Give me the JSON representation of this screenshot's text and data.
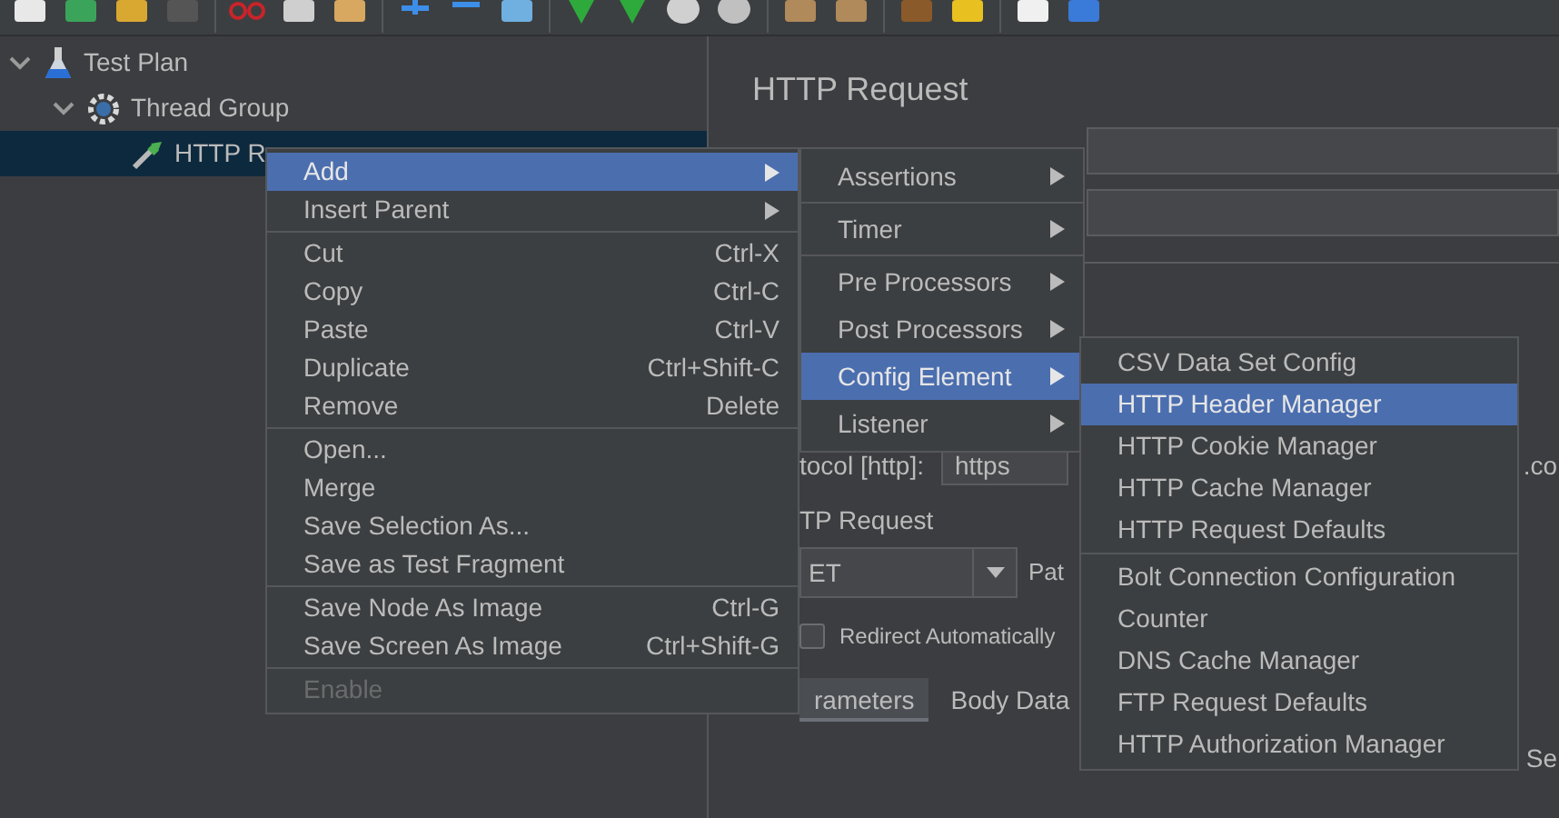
{
  "tree": [
    {
      "label": "Test Plan",
      "kind": "test_plan",
      "expanded": true,
      "selected": false,
      "children": [
        {
          "label": "Thread Group",
          "kind": "thread_group",
          "expanded": true,
          "selected": false,
          "children": [
            {
              "label": "HTTP R",
              "kind": "sampler",
              "selected": true
            }
          ]
        }
      ]
    }
  ],
  "panel": {
    "title": "HTTP Request",
    "protocol_label": "tocol [http]:",
    "protocol_value": "https",
    "server_fragment": ".co",
    "fieldset_legend": "TP Request",
    "method_value": "ET",
    "path_label": "Pat",
    "redirect": {
      "label": "Redirect Automatically",
      "checked": false
    },
    "tabs": [
      {
        "label": "rameters",
        "selected": true
      },
      {
        "label": "Body Data",
        "selected": false
      }
    ],
    "right_fragment": "Se"
  },
  "context_menu": {
    "items": [
      {
        "kind": "item",
        "label": "Add",
        "submenu": true,
        "selected": true,
        "disabled": false
      },
      {
        "kind": "item",
        "label": "Insert Parent",
        "submenu": true,
        "selected": false,
        "disabled": false
      },
      {
        "kind": "separator"
      },
      {
        "kind": "item",
        "label": "Cut",
        "shortcut": "Ctrl-X",
        "submenu": false,
        "selected": false,
        "disabled": false
      },
      {
        "kind": "item",
        "label": "Copy",
        "shortcut": "Ctrl-C",
        "submenu": false,
        "selected": false,
        "disabled": false
      },
      {
        "kind": "item",
        "label": "Paste",
        "shortcut": "Ctrl-V",
        "submenu": false,
        "selected": false,
        "disabled": false
      },
      {
        "kind": "item",
        "label": "Duplicate",
        "shortcut": "Ctrl+Shift-C",
        "submenu": false,
        "selected": false,
        "disabled": false
      },
      {
        "kind": "item",
        "label": "Remove",
        "shortcut": "Delete",
        "submenu": false,
        "selected": false,
        "disabled": false
      },
      {
        "kind": "separator"
      },
      {
        "kind": "item",
        "label": "Open...",
        "submenu": false,
        "selected": false,
        "disabled": false
      },
      {
        "kind": "item",
        "label": "Merge",
        "submenu": false,
        "selected": false,
        "disabled": false
      },
      {
        "kind": "item",
        "label": "Save Selection As...",
        "submenu": false,
        "selected": false,
        "disabled": false
      },
      {
        "kind": "item",
        "label": "Save as Test Fragment",
        "submenu": false,
        "selected": false,
        "disabled": false
      },
      {
        "kind": "separator"
      },
      {
        "kind": "item",
        "label": "Save Node As Image",
        "shortcut": "Ctrl-G",
        "submenu": false,
        "selected": false,
        "disabled": false
      },
      {
        "kind": "item",
        "label": "Save Screen As Image",
        "shortcut": "Ctrl+Shift-G",
        "submenu": false,
        "selected": false,
        "disabled": false
      },
      {
        "kind": "separator"
      },
      {
        "kind": "item",
        "label": "Enable",
        "submenu": false,
        "selected": false,
        "disabled": true
      }
    ]
  },
  "add_submenu": {
    "items": [
      {
        "kind": "item",
        "label": "Assertions",
        "submenu": true,
        "selected": false
      },
      {
        "kind": "separator"
      },
      {
        "kind": "item",
        "label": "Timer",
        "submenu": true,
        "selected": false
      },
      {
        "kind": "separator"
      },
      {
        "kind": "item",
        "label": "Pre Processors",
        "submenu": true,
        "selected": false
      },
      {
        "kind": "item",
        "label": "Post Processors",
        "submenu": true,
        "selected": false
      },
      {
        "kind": "item",
        "label": "Config Element",
        "submenu": true,
        "selected": true
      },
      {
        "kind": "item",
        "label": "Listener",
        "submenu": true,
        "selected": false
      }
    ]
  },
  "config_submenu": {
    "items": [
      {
        "kind": "item",
        "label": "CSV Data Set Config",
        "selected": false
      },
      {
        "kind": "item",
        "label": "HTTP Header Manager",
        "selected": true
      },
      {
        "kind": "item",
        "label": "HTTP Cookie Manager",
        "selected": false
      },
      {
        "kind": "item",
        "label": "HTTP Cache Manager",
        "selected": false
      },
      {
        "kind": "item",
        "label": "HTTP Request Defaults",
        "selected": false
      },
      {
        "kind": "separator"
      },
      {
        "kind": "item",
        "label": "Bolt Connection Configuration",
        "selected": false
      },
      {
        "kind": "item",
        "label": "Counter",
        "selected": false
      },
      {
        "kind": "item",
        "label": "DNS Cache Manager",
        "selected": false
      },
      {
        "kind": "item",
        "label": "FTP Request Defaults",
        "selected": false
      },
      {
        "kind": "item",
        "label": "HTTP Authorization Manager",
        "selected": false
      }
    ]
  }
}
